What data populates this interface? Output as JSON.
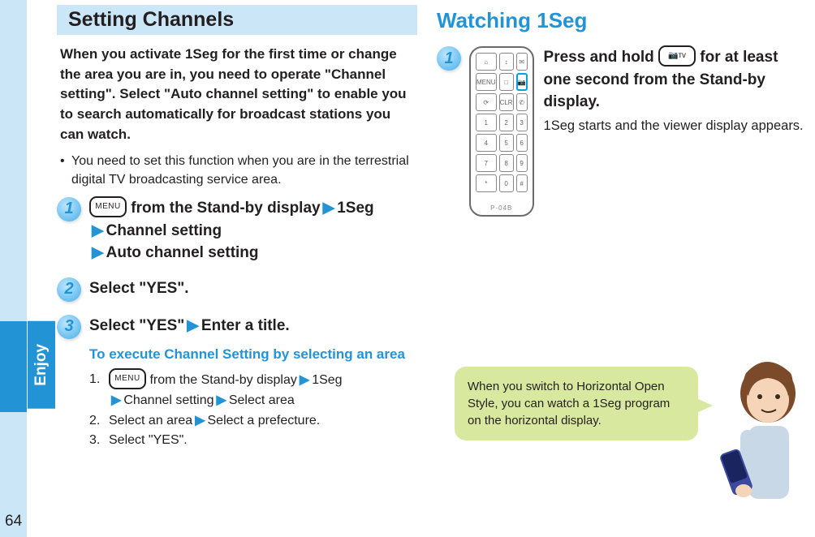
{
  "page_number": "64",
  "side_tab_label": "Enjoy",
  "left": {
    "section_title": "Setting Channels",
    "intro": "When you activate 1Seg for the first time or change the area you are in, you need to operate \"Channel setting\". Select \"Auto channel setting\" to enable you to search automatically for broadcast stations you can watch.",
    "bullet": "You need to set this function when you are in the terrestrial digital TV broadcasting service area.",
    "step1": {
      "num": "1",
      "menu_label": "MENU",
      "part_a": " from the Stand-by display",
      "arrow": "▶",
      "part_b": "1Seg",
      "line2_a": "Channel setting",
      "line3_a": "Auto channel setting"
    },
    "step2": {
      "num": "2",
      "text": "Select \"YES\"."
    },
    "step3": {
      "num": "3",
      "text_a": "Select \"YES\"",
      "text_b": "Enter a title.",
      "sub_head": "To execute Channel Setting by selecting an area",
      "li1_n": "1.",
      "li1_menu": "MENU",
      "li1_a": " from the Stand-by display",
      "li1_b": "1Seg",
      "li1_c": "Channel setting",
      "li1_d": "Select area",
      "li2_n": "2.",
      "li2_a": "Select an area",
      "li2_b": "Select a prefecture.",
      "li3_n": "3.",
      "li3_a": "Select \"YES\"."
    }
  },
  "right": {
    "section_title": "Watching 1Seg",
    "step1": {
      "num": "1",
      "camtv_label": "📷ᴛᴠ",
      "text_a": "Press and hold ",
      "text_b": " for at least one second from the Stand-by display.",
      "note": "1Seg starts and the viewer display appears."
    },
    "bubble": "When you switch to Horizontal Open Style, you can watch a 1Seg program on the horizontal display.",
    "phone": {
      "brand": "P-04B",
      "keys": [
        "⌂",
        "↕",
        "✉",
        "MENU",
        "□",
        "📷",
        "⟳",
        "CLR",
        "✆",
        "1",
        "2",
        "3",
        "4",
        "5",
        "6",
        "7",
        "8",
        "9",
        "*",
        "0",
        "#"
      ],
      "highlight_index": 5
    }
  }
}
